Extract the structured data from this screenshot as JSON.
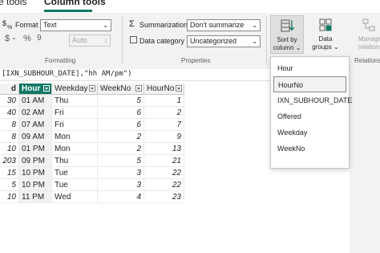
{
  "tabs": {
    "table_tools": "e tools",
    "column_tools": "Column tools"
  },
  "formatting": {
    "format_label": "Format",
    "format_value": "Text",
    "currency_glyph": "$",
    "percent_glyph": "%",
    "comma_glyph": "9",
    "auto_value": "Auto",
    "group_label": "Formatting"
  },
  "properties": {
    "summarization_label": "Summarization",
    "summarization_value": "Don't summarize",
    "data_category_label": "Data category",
    "data_category_value": "Uncategorized",
    "group_label": "Properties"
  },
  "sort": {
    "label_line1": "Sort by",
    "label_line2": "column"
  },
  "groups": {
    "label_line1": "Data",
    "label_line2": "groups"
  },
  "manage": {
    "label_line1": "Manage",
    "label_line2": "relationship",
    "group_label": "Relationship"
  },
  "formula": "[IXN_SUBHOUR_DATE],\"hh AM/pm\")",
  "table": {
    "headers": {
      "first": "d",
      "hour": "Hour",
      "weekday": "Weekday",
      "weekno": "WeekNo",
      "hourno": "HourNo"
    },
    "rows": [
      {
        "first": "30",
        "hour": "01 AM",
        "weekday": "Thu",
        "weekno": "5",
        "hourno": "1"
      },
      {
        "first": "40",
        "hour": "02 AM",
        "weekday": "Fri",
        "weekno": "6",
        "hourno": "2"
      },
      {
        "first": "8",
        "hour": "07 AM",
        "weekday": "Fri",
        "weekno": "6",
        "hourno": "7"
      },
      {
        "first": "8",
        "hour": "09 AM",
        "weekday": "Mon",
        "weekno": "2",
        "hourno": "9"
      },
      {
        "first": "10",
        "hour": "01 PM",
        "weekday": "Mon",
        "weekno": "2",
        "hourno": "13"
      },
      {
        "first": "203",
        "hour": "09 PM",
        "weekday": "Thu",
        "weekno": "5",
        "hourno": "21"
      },
      {
        "first": "15",
        "hour": "10 PM",
        "weekday": "Tue",
        "weekno": "3",
        "hourno": "22"
      },
      {
        "first": "5",
        "hour": "10 PM",
        "weekday": "Tue",
        "weekno": "3",
        "hourno": "22"
      },
      {
        "first": "10",
        "hour": "11 PM",
        "weekday": "Wed",
        "weekno": "4",
        "hourno": "23"
      }
    ]
  },
  "sort_menu": {
    "items": [
      "Hour",
      "HourNo",
      "IXN_SUBHOUR_DATE",
      "Offered",
      "Weekday",
      "WeekNo"
    ],
    "selected": "HourNo"
  },
  "colors": {
    "accent": "#117865",
    "ribbon": "#f3f2f1"
  }
}
